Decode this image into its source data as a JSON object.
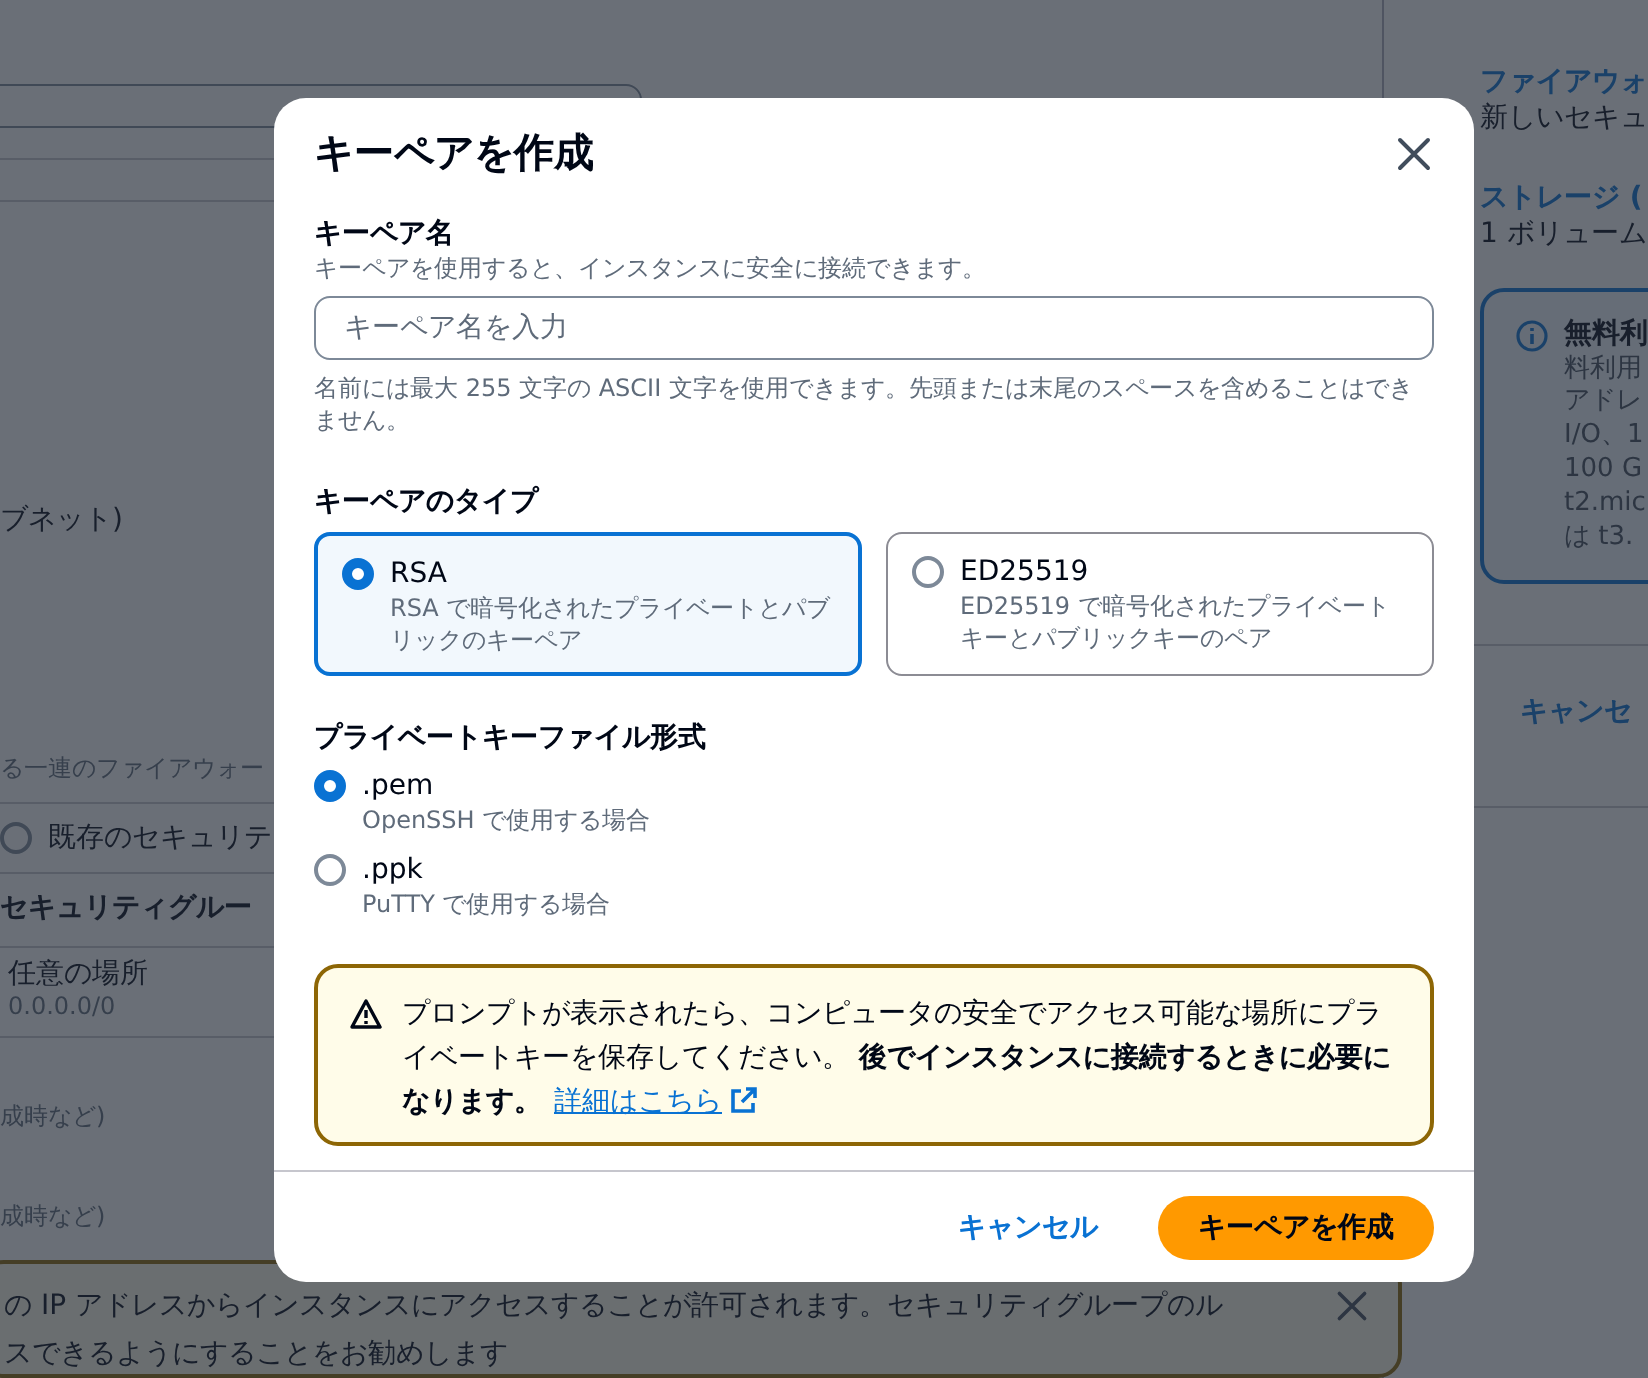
{
  "page": {
    "main": {
      "subnet_label": "ブネット)",
      "firewall_desc": "る一連のファイアウォー",
      "sg_options": [
        {
          "label": "既存のセキュリテ",
          "selected": false
        }
      ],
      "rules_heading": "セキュリティグルー",
      "source": {
        "label": "任意の場所",
        "value": "0.0.0.0/0"
      },
      "notes": [
        "成時など)",
        "成時など)"
      ],
      "banner": {
        "lines": [
          "の IP アドレスからインスタンスにアクセスすることが許可されます。セキュリティグループのル",
          "スできるようにすることをお勧めします"
        ]
      }
    },
    "summary": {
      "sections": [
        {
          "title": "ファイアウォ",
          "value": "新しいセキュ"
        },
        {
          "title": "ストレージ (",
          "value": "1 ボリューム"
        }
      ],
      "free_tier": {
        "title": "無料利",
        "lines": [
          "料利用",
          "アドレ",
          "I/O、1",
          "100 G",
          "t2.mic",
          "は t3."
        ]
      },
      "cancel": "キャンセ"
    }
  },
  "dialog": {
    "title": "キーペアを作成",
    "name_field": {
      "label": "キーペア名",
      "description": "キーペアを使用すると、インスタンスに安全に接続できます。",
      "placeholder": "キーペア名を入力",
      "constraint": "名前には最大 255 文字の ASCII 文字を使用できます。先頭または末尾のスペースを含めることはできません。"
    },
    "key_type": {
      "label": "キーペアのタイプ",
      "options": [
        {
          "title": "RSA",
          "description": "RSA で暗号化されたプライベートとパブリックのキーペア",
          "selected": true
        },
        {
          "title": "ED25519",
          "description": "ED25519 で暗号化されたプライベートキーとパブリックキーのペア",
          "selected": false
        }
      ]
    },
    "file_format": {
      "label": "プライベートキーファイル形式",
      "options": [
        {
          "title": ".pem",
          "description": "OpenSSH で使用する場合",
          "selected": true
        },
        {
          "title": ".ppk",
          "description": "PuTTY で使用する場合",
          "selected": false
        }
      ]
    },
    "alert": {
      "text": "プロンプトが表示されたら、コンピュータの安全でアクセス可能な場所にプライベートキーを保存してください。 **後でインスタンスに接続するときに必要になります。**",
      "link": "詳細はこちら"
    },
    "buttons": [
      {
        "label": "キャンセル",
        "kind": "link"
      },
      {
        "label": "キーペアを作成",
        "kind": "primary"
      }
    ]
  }
}
